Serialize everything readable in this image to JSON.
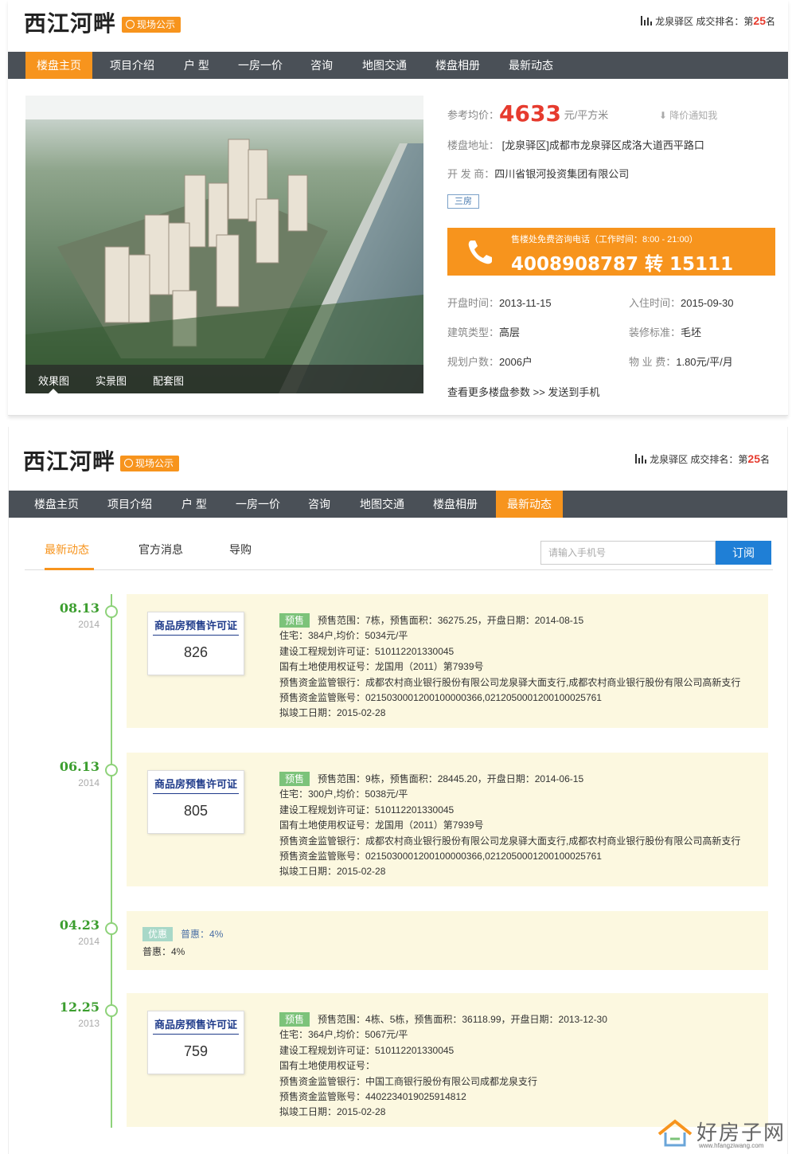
{
  "project": {
    "name": "西江河畔",
    "badge": "现场公示",
    "rank_prefix": "龙泉驿区 成交排名：第",
    "rank_num": "25",
    "rank_suffix": "名"
  },
  "nav": [
    {
      "label": "楼盘主页"
    },
    {
      "label": "项目介绍"
    },
    {
      "label": "户 型"
    },
    {
      "label": "一房一价"
    },
    {
      "label": "咨询"
    },
    {
      "label": "地图交通"
    },
    {
      "label": "楼盘相册"
    },
    {
      "label": "最新动态"
    }
  ],
  "card1_active_nav": "楼盘主页",
  "card2_active_nav": "最新动态",
  "photo_tabs": [
    "效果图",
    "实景图",
    "配套图"
  ],
  "info": {
    "price_label": "参考均价：",
    "price": "4633",
    "price_unit": "元/平方米",
    "price_notice": "降价通知我",
    "address_label": "楼盘地址：",
    "address": "[龙泉驿区]成都市龙泉驿区成洛大道西平路口",
    "developer_label": "开 发 商：",
    "developer": "四川省银河投资集团有限公司",
    "tag": "三房",
    "hotline_tip": "售楼处免费咨询电话（工作时间：8:00 - 21:00）",
    "hotline": "4008908787 转 15111",
    "open_label": "开盘时间：",
    "open": "2013-11-15",
    "checkin_label": "入住时间：",
    "checkin": "2015-09-30",
    "type_label": "建筑类型：",
    "type": "高层",
    "decor_label": "装修标准：",
    "decor": "毛坯",
    "units_label": "规划户数：",
    "units": "2006户",
    "fee_label": "物 业 费：",
    "fee": "1.80元/平/月",
    "more": "查看更多楼盘参数 >> 发送到手机"
  },
  "subtabs": [
    "最新动态",
    "官方消息",
    "导购"
  ],
  "subscribe": {
    "placeholder": "请输入手机号",
    "button": "订阅"
  },
  "timeline": [
    {
      "date": "08.13",
      "year": "2014",
      "kind": "permit",
      "permit_title": "商品房预售许可证",
      "permit_no": "826",
      "tag": "预售",
      "lines": [
        "预售范围：7栋，预售面积：36275.25，开盘日期：2014-08-15",
        "住宅：384户,均价：5034元/平",
        "建设工程规划许可证：510112201330045",
        "国有土地使用权证号：龙国用（2011）第7939号",
        "预售资金监管银行：成都农村商业银行股份有限公司龙泉驿大面支行,成都农村商业银行股份有限公司高新支行",
        "预售资金监管账号：0215030001200100000366,0212050001200100025761",
        "拟竣工日期：2015-02-28"
      ]
    },
    {
      "date": "06.13",
      "year": "2014",
      "kind": "permit",
      "permit_title": "商品房预售许可证",
      "permit_no": "805",
      "tag": "预售",
      "lines": [
        "预售范围：9栋，预售面积：28445.20，开盘日期：2014-06-15",
        "住宅：300户,均价：5038元/平",
        "建设工程规划许可证：510112201330045",
        "国有土地使用权证号：龙国用（2011）第7939号",
        "预售资金监管银行：成都农村商业银行股份有限公司龙泉驿大面支行,成都农村商业银行股份有限公司高新支行",
        "预售资金监管账号：0215030001200100000366,0212050001200100025761",
        "拟竣工日期：2015-02-28"
      ]
    },
    {
      "date": "04.23",
      "year": "2014",
      "kind": "promo",
      "tag": "优惠",
      "head": "普惠：4%",
      "body": "普惠：4%"
    },
    {
      "date": "12.25",
      "year": "2013",
      "kind": "permit",
      "permit_title": "商品房预售许可证",
      "permit_no": "759",
      "tag": "预售",
      "lines": [
        "预售范围：4栋、5栋，预售面积：36118.99，开盘日期：2013-12-30",
        "住宅：364户,均价：5067元/平",
        "建设工程规划许可证：510112201330045",
        "国有土地使用权证号：",
        "预售资金监管银行：中国工商银行股份有限公司成都龙泉支行",
        "预售资金监管账号：4402234019025914812",
        "拟竣工日期：2015-02-28"
      ]
    }
  ],
  "watermark": {
    "text": "好房子网",
    "url": "www.hfangziwang.com"
  },
  "colors": {
    "accent": "#f7941d",
    "nav_bg": "#4a5057",
    "price_red": "#e63b2e",
    "subscribe_blue": "#1f7fd6",
    "timeline_green": "#3c9e2f",
    "entry_bg": "#fcf8e0"
  }
}
